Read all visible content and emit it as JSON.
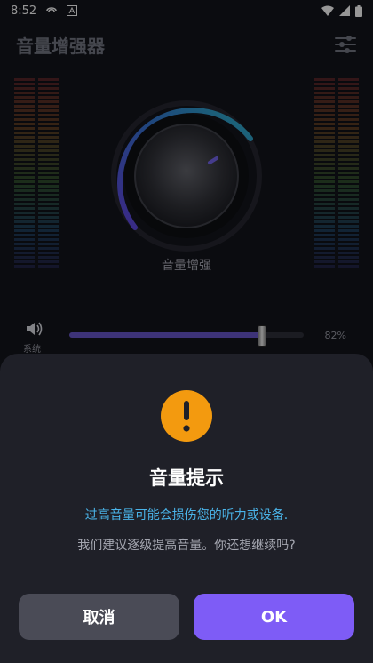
{
  "status_bar": {
    "time": "8:52"
  },
  "header": {
    "title": "音量增强器"
  },
  "knob": {
    "label": "音量增强"
  },
  "volume": {
    "channel_label": "系统",
    "level_percent": 82,
    "percent_text": "82%"
  },
  "dialog": {
    "title": "音量提示",
    "warning": "过高音量可能会损伤您的听力或设备.",
    "description": "我们建议逐级提高音量。你还想继续吗?",
    "cancel_label": "取消",
    "ok_label": "OK"
  },
  "colors": {
    "accent": "#7E5CF6",
    "warning_icon": "#F39A0F",
    "warning_text": "#4AB3E8",
    "sheet_bg": "#1F2028",
    "cancel_bg": "#4A4B56"
  }
}
